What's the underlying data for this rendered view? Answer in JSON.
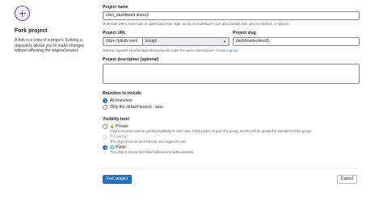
{
  "left_panel": {
    "title": "Fork project",
    "description": "A fork is a copy of a project. Forking a repository allows you to make changes without affecting the original project.",
    "icon": "fork-plus-icon"
  },
  "project_name": {
    "label": "Project name",
    "value": "sliex_dashboard sliexv3",
    "help": "Must start with a lowercase or uppercase letter, digit, emoji, or underscore. Can also contain dots, pluses, dashes, or spaces."
  },
  "project_url": {
    "label": "Project URL",
    "prefix": "https://gitlab.com/",
    "namespace": "lexuyo",
    "chevron_icon": "chevron-down-icon"
  },
  "project_slug": {
    "label": "Project slug",
    "value": "dashboard-sliexv3"
  },
  "namespace_help": {
    "text": "Want to organize several dependent projects under the same namespace?",
    "link": "Create a group"
  },
  "description": {
    "label": "Project description (optional)",
    "value": ""
  },
  "branches": {
    "label": "Branches to include",
    "options": [
      {
        "label": "All branches",
        "checked": true
      },
      {
        "label": "Only the default branch",
        "tag": "main",
        "checked": false
      }
    ]
  },
  "visibility": {
    "label": "Visibility level",
    "help_icon": "question-icon",
    "options": [
      {
        "label": "Private",
        "icon": "lock-icon",
        "help": "Project access must be granted explicitly to each user. If this project is part of a group, access will be granted to members of the group.",
        "checked": false,
        "disabled": false
      },
      {
        "label": "Internal",
        "icon": "shield-icon",
        "help": "The project can be accessed by any logged in user.",
        "checked": false,
        "disabled": true
      },
      {
        "label": "Public",
        "icon": "earth-icon",
        "help": "The project can be accessed without any authentication.",
        "checked": true,
        "disabled": false
      }
    ]
  },
  "actions": {
    "submit": "Fork project",
    "cancel": "Cancel"
  },
  "colors": {
    "primary": "#1f75cb",
    "accent_purple": "#6e49cb",
    "text": "#333238",
    "muted": "#626168"
  }
}
